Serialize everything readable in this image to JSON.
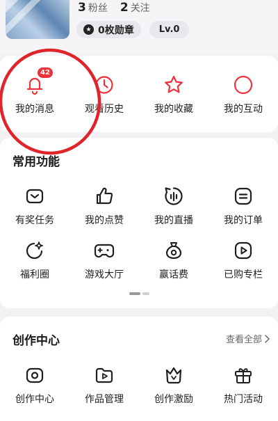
{
  "profile": {
    "followers_count": "3",
    "followers_label": "粉丝",
    "following_count": "2",
    "following_label": "关注",
    "medals_label": "0枚勋章",
    "level_label": "Lv.0"
  },
  "quick": {
    "items": [
      {
        "label": "我的消息",
        "icon": "bell-icon",
        "badge": "42"
      },
      {
        "label": "观看历史",
        "icon": "clock-icon"
      },
      {
        "label": "我的收藏",
        "icon": "star-icon"
      },
      {
        "label": "我的互动",
        "icon": "circle-icon"
      }
    ]
  },
  "common": {
    "title": "常用功能",
    "items": [
      {
        "label": "有奖任务",
        "icon": "reward-box-icon"
      },
      {
        "label": "我的点赞",
        "icon": "thumbs-up-icon"
      },
      {
        "label": "我的直播",
        "icon": "live-audio-icon"
      },
      {
        "label": "我的订单",
        "icon": "order-icon"
      },
      {
        "label": "福利圈",
        "icon": "welfare-sparkle-icon"
      },
      {
        "label": "游戏大厅",
        "icon": "gamepad-icon"
      },
      {
        "label": "赢话费",
        "icon": "money-bag-icon"
      },
      {
        "label": "已购专栏",
        "icon": "play-box-icon"
      }
    ]
  },
  "creator": {
    "title": "创作中心",
    "see_all": "查看全部",
    "items": [
      {
        "label": "创作中心",
        "icon": "camera-icon"
      },
      {
        "label": "作品管理",
        "icon": "folder-play-icon"
      },
      {
        "label": "创作激励",
        "icon": "crown-icon"
      },
      {
        "label": "热门活动",
        "icon": "gift-icon"
      }
    ]
  },
  "colors": {
    "accent_red": "#f0313a",
    "annotation_red": "#e0242c",
    "background": "#f2f2f4",
    "card": "#ffffff"
  }
}
